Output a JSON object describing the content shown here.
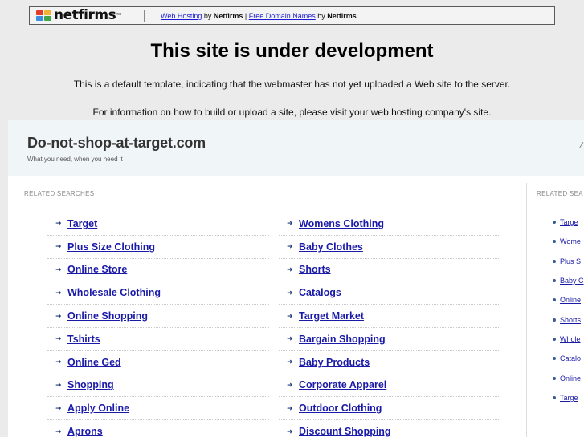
{
  "netfirms_bar": {
    "logo_text": "netfirms",
    "logo_tm": "™",
    "web_hosting_link": "Web Hosting",
    "by1": " by ",
    "brand1": "Netfirms",
    "pipe": " | ",
    "domain_link": "Free Domain Names",
    "by2": " by ",
    "brand2": "Netfirms",
    "logo_colors": [
      "#e23b2e",
      "#f2b233",
      "#3b8ee0",
      "#41a34a"
    ]
  },
  "notice": {
    "headline": "This site is under development",
    "line1": "This is a default template, indicating that the webmaster has not yet uploaded a Web site to the server.",
    "line2": "For information on how to build or upload a site, please visit your web hosting company's site."
  },
  "parked": {
    "site_title": "Do-not-shop-at-target.com",
    "tagline": "What you need, when you need it",
    "header_edge_glyph": "∕",
    "related_label": "RELATED SEARCHES",
    "related_label_right": "RELATED SEA",
    "arrow_glyph": "➜",
    "col1": [
      "Target",
      "Plus Size Clothing",
      "Online Store",
      "Wholesale Clothing",
      "Online Shopping",
      "Tshirts",
      "Online Ged",
      "Shopping",
      "Apply Online",
      "Aprons"
    ],
    "col2": [
      "Womens Clothing",
      "Baby Clothes",
      "Shorts",
      "Catalogs",
      "Target Market",
      "Bargain Shopping",
      "Baby Products",
      "Corporate Apparel",
      "Outdoor Clothing",
      "Discount Shopping"
    ],
    "side": [
      "Targe",
      "Wome",
      "Plus S",
      "Baby C",
      "Online",
      "Shorts",
      "Whole",
      "Catalo",
      "Online",
      "Targe"
    ]
  }
}
